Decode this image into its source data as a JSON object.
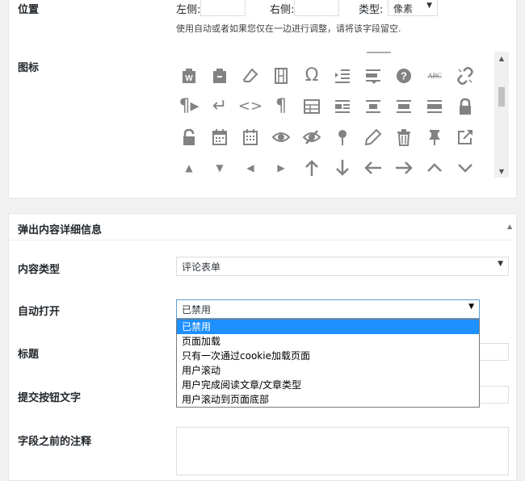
{
  "position": {
    "label": "位置",
    "left_label": "左侧:",
    "right_label": "右侧:",
    "type_label": "类型:",
    "unit_value": "像素",
    "help": "使用自动或者如果您仅在一边进行调整，请将该字段留空."
  },
  "icon_section": {
    "label": "图标",
    "icons": [
      [
        "archive-w-icon",
        "clipboard-icon",
        "eraser-icon",
        "film-icon",
        "omega-icon",
        "indent-icon",
        "align-list-icon",
        "help-icon",
        "strikethrough-abc-icon",
        "unlink-icon"
      ],
      [
        "paragraph-ltr-icon",
        "return-arrow-icon",
        "code-brackets-icon",
        "pilcrow-icon",
        "table-icon",
        "align-left-icon",
        "align-center-icon",
        "align-right-icon",
        "align-justify-icon",
        "lock-icon"
      ],
      [
        "unlock-icon",
        "calendar-icon",
        "calendar-alt-icon",
        "visibility-icon",
        "hidden-icon",
        "location-pin-icon",
        "edit-pencil-icon",
        "trash-icon",
        "pin-icon",
        "external-link-icon"
      ],
      [
        "triangle-up-icon",
        "triangle-down-icon",
        "triangle-left-icon",
        "triangle-right-icon",
        "arrow-up-icon",
        "arrow-down-icon",
        "arrow-left-icon",
        "arrow-right-icon",
        "chevron-up-icon",
        "chevron-down-icon"
      ]
    ],
    "abc_text": "ABC"
  },
  "popup_section": {
    "title": "弹出内容详细信息",
    "content_type_label": "内容类型",
    "content_type_value": "评论表单",
    "auto_open_label": "自动打开",
    "auto_open_value": "已禁用",
    "auto_open_options": [
      "已禁用",
      "页面加载",
      "只有一次通过cookie加载页面",
      "用户滚动",
      "用户完成阅读文章/文章类型",
      "用户滚动到页面底部"
    ],
    "title_label": "标题",
    "submit_label": "提交按钮文字",
    "before_field_note_label": "字段之前的注释"
  },
  "colors": {
    "accent_blue": "#1e90ff",
    "icon_gray": "#828282"
  }
}
